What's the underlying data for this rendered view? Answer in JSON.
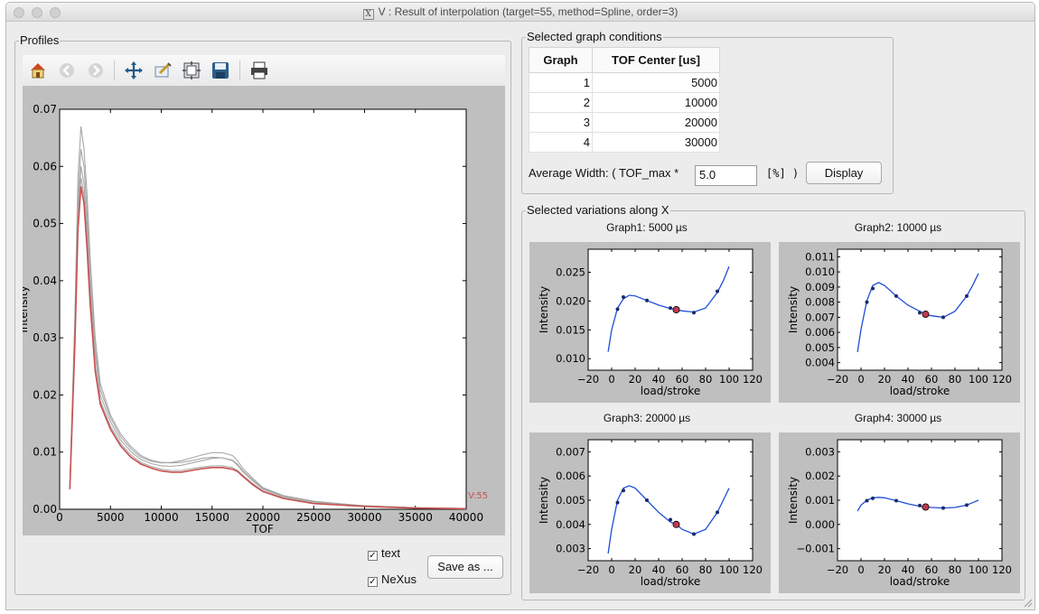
{
  "window": {
    "title": "V :  Result of interpolation (target=55, method=Spline, order=3)",
    "title_icon": "X"
  },
  "profiles": {
    "group_title": "Profiles",
    "toolbar": [
      "home-icon",
      "back-icon",
      "forward-icon",
      "pan-icon",
      "zoom-icon",
      "subplots-icon",
      "save-icon",
      "print-icon"
    ],
    "checkbox_text_label": "text",
    "checkbox_text_checked": true,
    "checkbox_nexus_label": "NeXus",
    "checkbox_nexus_checked": true,
    "save_button_label": "Save as ...",
    "target_label": "V:55"
  },
  "conditions": {
    "group_title": "Selected graph conditions",
    "headers": [
      "Graph",
      "TOF Center [us]"
    ],
    "rows": [
      [
        "1",
        "5000"
      ],
      [
        "2",
        "10000"
      ],
      [
        "3",
        "20000"
      ],
      [
        "4",
        "30000"
      ]
    ],
    "avg_width_label": "Average Width: ( TOF_max *",
    "avg_width_value": "5.0",
    "percent_label": "[%] )",
    "display_button_label": "Display"
  },
  "variations": {
    "group_title": "Selected variations along X"
  },
  "colors": {
    "target_line": "#c8504f",
    "other_lines": "#a8a8a8",
    "spline": "#1f4fd6",
    "marker_fill": "#c03a4c"
  },
  "chart_data": [
    {
      "type": "line",
      "xlabel": "TOF",
      "ylabel": "Intensity",
      "xlim": [
        0,
        40000
      ],
      "ylim": [
        0,
        0.07
      ],
      "xticks": [
        0,
        5000,
        10000,
        15000,
        20000,
        25000,
        30000,
        35000,
        40000
      ],
      "yticks": [
        0.0,
        0.01,
        0.02,
        0.03,
        0.04,
        0.05,
        0.06,
        0.07
      ],
      "x": [
        1000,
        1500,
        1800,
        2100,
        2400,
        2700,
        3000,
        3500,
        4000,
        5000,
        6000,
        7000,
        8000,
        9000,
        10000,
        11000,
        12000,
        13000,
        14000,
        15000,
        16000,
        17000,
        17500,
        18000,
        19000,
        20000,
        22000,
        25000,
        30000,
        35000,
        40000
      ],
      "series": [
        {
          "values": [
            0.004,
            0.03,
            0.05,
            0.058,
            0.055,
            0.047,
            0.037,
            0.025,
            0.019,
            0.0145,
            0.0115,
            0.0095,
            0.0082,
            0.0075,
            0.007,
            0.0068,
            0.0068,
            0.0071,
            0.0074,
            0.0076,
            0.0076,
            0.0073,
            0.0068,
            0.006,
            0.0045,
            0.0032,
            0.002,
            0.0011,
            0.0005,
            0.0002,
            0.0001
          ]
        },
        {
          "values": [
            0.004,
            0.031,
            0.052,
            0.06,
            0.057,
            0.049,
            0.039,
            0.027,
            0.02,
            0.0153,
            0.0121,
            0.0101,
            0.0087,
            0.008,
            0.0076,
            0.0075,
            0.0077,
            0.0081,
            0.0085,
            0.0089,
            0.009,
            0.0086,
            0.0079,
            0.0068,
            0.0051,
            0.0036,
            0.0023,
            0.0013,
            0.0006,
            0.00025,
            0.00012
          ]
        },
        {
          "values": [
            0.004,
            0.032,
            0.054,
            0.063,
            0.06,
            0.052,
            0.041,
            0.028,
            0.021,
            0.016,
            0.0127,
            0.0106,
            0.0091,
            0.0084,
            0.0081,
            0.0082,
            0.0085,
            0.009,
            0.0095,
            0.0099,
            0.0099,
            0.0094,
            0.0085,
            0.0072,
            0.0054,
            0.0038,
            0.0024,
            0.0014,
            0.0006,
            0.00028,
            0.00013
          ]
        },
        {
          "values": [
            0.004,
            0.034,
            0.058,
            0.067,
            0.063,
            0.055,
            0.044,
            0.03,
            0.022,
            0.0165,
            0.0132,
            0.011,
            0.0094,
            0.0086,
            0.0082,
            0.0081,
            0.0082,
            0.0085,
            0.0089,
            0.0091,
            0.009,
            0.0085,
            0.0077,
            0.0066,
            0.005,
            0.0035,
            0.0022,
            0.0013,
            0.0006,
            0.00026,
            0.00012
          ]
        },
        {
          "name": "V:55",
          "values": [
            0.0035,
            0.029,
            0.049,
            0.0565,
            0.0535,
            0.0455,
            0.036,
            0.0242,
            0.0184,
            0.014,
            0.0111,
            0.0091,
            0.0079,
            0.0072,
            0.0067,
            0.0065,
            0.0065,
            0.0068,
            0.0071,
            0.0073,
            0.0073,
            0.007,
            0.0066,
            0.0058,
            0.0043,
            0.0031,
            0.0019,
            0.001,
            0.0005,
            0.0002,
            0.0001
          ]
        }
      ]
    },
    {
      "type": "line",
      "title": "Graph1: 5000 µs",
      "xlabel": "load/stroke",
      "ylabel": "Intensity",
      "xlim": [
        -20,
        120
      ],
      "ylim": [
        0.008,
        0.029
      ],
      "xticks": [
        -20,
        0,
        20,
        40,
        60,
        80,
        100,
        120
      ],
      "yticks": [
        0.01,
        0.015,
        0.02,
        0.025
      ],
      "ytick_labels": [
        "0.010",
        "0.015",
        "0.020",
        "0.025"
      ],
      "x": [
        -3,
        0,
        5,
        10,
        15,
        20,
        30,
        40,
        50,
        55,
        60,
        70,
        80,
        90,
        95,
        100
      ],
      "values": [
        0.0112,
        0.015,
        0.0188,
        0.0204,
        0.021,
        0.0209,
        0.0201,
        0.0193,
        0.0187,
        0.0185,
        0.0183,
        0.0181,
        0.0188,
        0.0215,
        0.0235,
        0.026
      ],
      "points_x": [
        5,
        10,
        30,
        50,
        70,
        90
      ],
      "points_y": [
        0.0186,
        0.0207,
        0.0201,
        0.0188,
        0.018,
        0.0217
      ],
      "target": [
        55,
        0.0185
      ]
    },
    {
      "type": "line",
      "title": "Graph2: 10000 µs",
      "xlabel": "load/stroke",
      "ylabel": "Intensity",
      "xlim": [
        -20,
        120
      ],
      "ylim": [
        0.0035,
        0.0115
      ],
      "xticks": [
        -20,
        0,
        20,
        40,
        60,
        80,
        100,
        120
      ],
      "yticks": [
        0.004,
        0.005,
        0.006,
        0.007,
        0.008,
        0.009,
        0.01,
        0.011
      ],
      "ytick_labels": [
        "0.004",
        "0.005",
        "0.006",
        "0.007",
        "0.008",
        "0.009",
        "0.010",
        "0.011"
      ],
      "x": [
        -3,
        0,
        5,
        10,
        15,
        20,
        30,
        40,
        50,
        55,
        60,
        70,
        80,
        90,
        95,
        100
      ],
      "values": [
        0.0047,
        0.0062,
        0.0081,
        0.0091,
        0.0093,
        0.0091,
        0.0084,
        0.0078,
        0.0074,
        0.0072,
        0.0071,
        0.007,
        0.0074,
        0.0084,
        0.0091,
        0.0099
      ],
      "points_x": [
        5,
        10,
        30,
        50,
        70,
        90
      ],
      "points_y": [
        0.008,
        0.0089,
        0.0084,
        0.0073,
        0.007,
        0.0084
      ],
      "target": [
        55,
        0.0072
      ]
    },
    {
      "type": "line",
      "title": "Graph3: 20000 µs",
      "xlabel": "load/stroke",
      "ylabel": "Intensity",
      "xlim": [
        -20,
        120
      ],
      "ylim": [
        0.0025,
        0.0075
      ],
      "xticks": [
        -20,
        0,
        20,
        40,
        60,
        80,
        100,
        120
      ],
      "yticks": [
        0.003,
        0.004,
        0.005,
        0.006,
        0.007
      ],
      "ytick_labels": [
        "0.003",
        "0.004",
        "0.005",
        "0.006",
        "0.007"
      ],
      "x": [
        -3,
        0,
        5,
        10,
        15,
        20,
        30,
        40,
        50,
        55,
        60,
        70,
        80,
        90,
        95,
        100
      ],
      "values": [
        0.0028,
        0.0038,
        0.005,
        0.0055,
        0.0056,
        0.0055,
        0.005,
        0.0045,
        0.0041,
        0.004,
        0.0038,
        0.0036,
        0.0038,
        0.0045,
        0.005,
        0.0055
      ],
      "points_x": [
        5,
        10,
        30,
        50,
        70,
        90
      ],
      "points_y": [
        0.0049,
        0.0054,
        0.005,
        0.0042,
        0.0036,
        0.0045
      ],
      "target": [
        55,
        0.004
      ]
    },
    {
      "type": "line",
      "title": "Graph4: 30000 µs",
      "xlabel": "load/stroke",
      "ylabel": "Intensity",
      "xlim": [
        -20,
        120
      ],
      "ylim": [
        -0.0015,
        0.0035
      ],
      "xticks": [
        -20,
        0,
        20,
        40,
        60,
        80,
        100,
        120
      ],
      "yticks": [
        -0.001,
        0.0,
        0.001,
        0.002,
        0.003
      ],
      "ytick_labels": [
        "-0.001",
        "0.000",
        "0.001",
        "0.002",
        "0.003"
      ],
      "x": [
        -3,
        0,
        5,
        10,
        15,
        20,
        30,
        40,
        50,
        55,
        60,
        70,
        80,
        90,
        95,
        100
      ],
      "values": [
        0.00055,
        0.0008,
        0.001,
        0.0011,
        0.00112,
        0.0011,
        0.00098,
        0.00085,
        0.00075,
        0.00072,
        0.0007,
        0.00068,
        0.0007,
        0.0008,
        0.0009,
        0.001
      ],
      "points_x": [
        5,
        10,
        30,
        50,
        70,
        90
      ],
      "points_y": [
        0.00098,
        0.00108,
        0.00098,
        0.00078,
        0.00068,
        0.0008
      ],
      "target": [
        55,
        0.00072
      ]
    }
  ]
}
